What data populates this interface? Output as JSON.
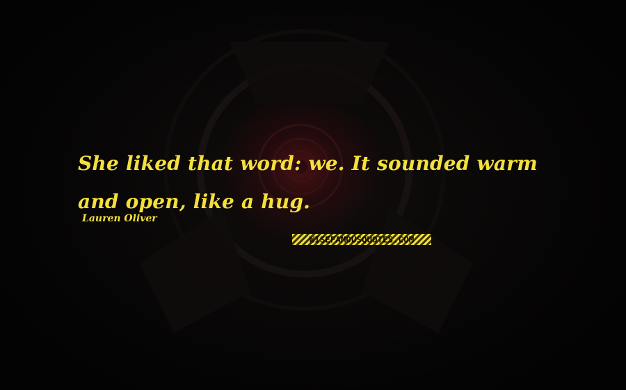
{
  "quote": {
    "text": "She liked that word: we. It sounded warm and open, like a hug.",
    "author": "Lauren Oliver"
  },
  "watermark": {
    "text": "WISEFAMOUSQUOTES.COM"
  },
  "colors": {
    "text": "#f4e03c",
    "background": "#050404",
    "accent_glow": "#781419"
  }
}
